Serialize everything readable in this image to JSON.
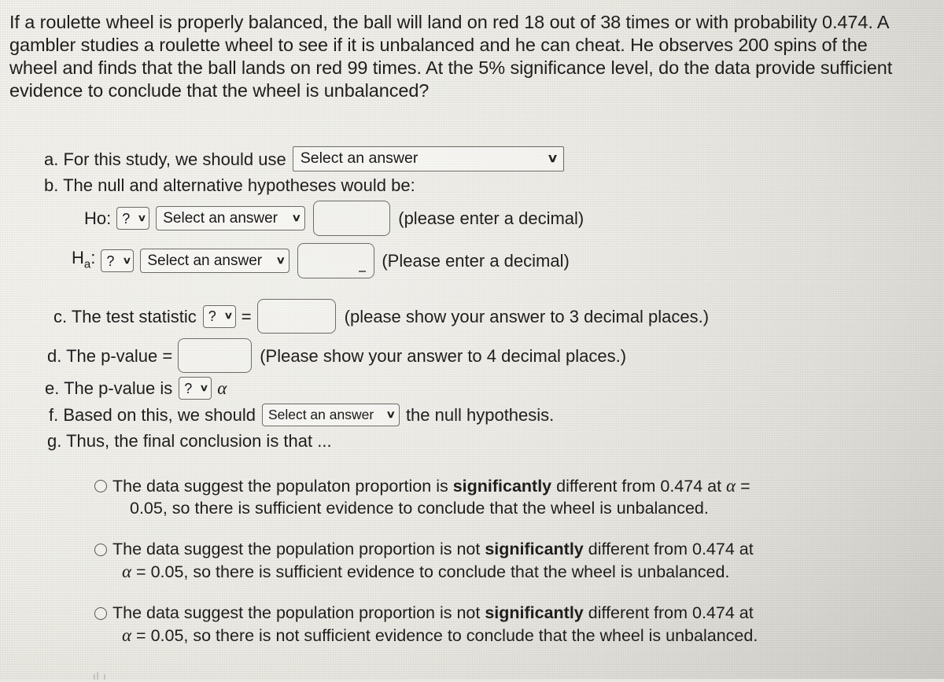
{
  "prompt": "If a roulette wheel is properly balanced, the ball will land on red 18 out of 38 times or with probability 0.474. A gambler studies a roulette wheel to see if it is unbalanced and he can cheat. He observes 200 spins of the wheel and finds that the ball lands on red 99 times. At the 5% significance level, do the data provide sufficient evidence to conclude that the wheel is unbalanced?",
  "parts": {
    "a": {
      "label": "a. For this study, we should use",
      "select_value": "Select an answer"
    },
    "b": {
      "label": "b. The null and alternative hypotheses would be:",
      "null_row": {
        "prefix": "Ho:",
        "comparator_value": "?",
        "param_select_value": "Select an answer",
        "input_value": "",
        "hint": "(please enter a decimal)"
      },
      "alt_row": {
        "prefix_main": "H",
        "prefix_sub": "a",
        "prefix_colon": ":",
        "comparator_value": "?",
        "param_select_value": "Select an answer",
        "input_value": "",
        "hint": "(Please enter a decimal)"
      }
    },
    "c": {
      "label": "c. The test statistic",
      "statistic_value": "?",
      "equals": "=",
      "input_value": "",
      "hint": "(please show your answer to 3 decimal places.)"
    },
    "d": {
      "label": "d. The p-value =",
      "input_value": "",
      "hint": "(Please show your answer to 4 decimal places.)"
    },
    "e": {
      "label": "e. The p-value is",
      "comparator_value": "?",
      "alpha_symbol": "α"
    },
    "f": {
      "label_before": "f. Based on this, we should",
      "select_value": "Select an answer",
      "label_after": "the null hypothesis."
    },
    "g": {
      "label": "g. Thus, the final conclusion is that ..."
    }
  },
  "options": [
    {
      "id": "option-significantly-different-sufficient",
      "selected": false,
      "line1_pre": "The data suggest the populaton proportion is ",
      "line1_bold": "significantly",
      "line1_post": " different from 0.474 at ",
      "line1_alpha": "α",
      "line1_eq": " =",
      "line2": "0.05, so there is sufficient evidence to conclude that the wheel is unbalanced."
    },
    {
      "id": "option-not-significantly-different-sufficient",
      "selected": false,
      "line1_pre": "The data suggest the population proportion is not ",
      "line1_bold": "significantly",
      "line1_post": " different from 0.474 at",
      "line1_alpha": "",
      "line1_eq": "",
      "line2_alpha": "α",
      "line2": " = 0.05, so there is sufficient evidence to conclude that the wheel is unbalanced."
    },
    {
      "id": "option-not-significantly-different-not-sufficient",
      "selected": false,
      "line1_pre": "The data suggest the population proportion is not ",
      "line1_bold": "significantly",
      "line1_post": " different from 0.474 at",
      "line1_alpha": "",
      "line1_eq": "",
      "line2_alpha": "α",
      "line2": " = 0.05, so there is not sufficient evidence to conclude that the wheel is unbalanced."
    }
  ],
  "icons": {
    "dropdown_caret": "∨",
    "radio_unselected": "radio-circle"
  },
  "colors": {
    "text": "#201d1e",
    "background": "#e9e7e1",
    "control_border": "#6d6a64"
  },
  "bottom_smudge": "ıl ı"
}
